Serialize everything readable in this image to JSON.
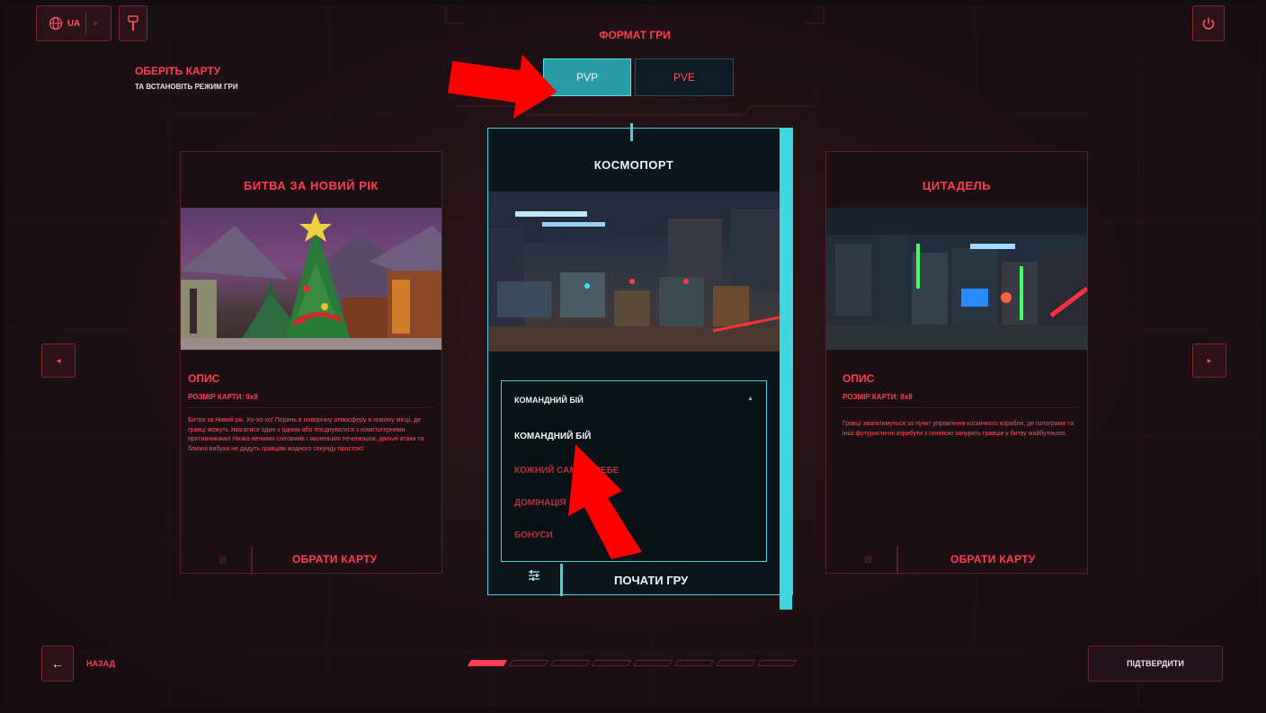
{
  "top": {
    "language": "UA",
    "game_format_label": "ФОРМАТ ГРИ",
    "select_map_title": "ОБЕРІТЬ КАРТУ",
    "select_map_subtitle": "ТА ВСТАНОВІТЬ РЕЖИМ ГРИ",
    "mode_tabs": [
      {
        "label": "PVP",
        "active": true
      },
      {
        "label": "PVE",
        "active": false
      }
    ]
  },
  "cards": {
    "left": {
      "title": "БИТВА ЗА НОВИЙ РІК",
      "description_title": "ОПИС",
      "map_size": "РОЗМІР КАРТИ: 9x8",
      "description": "Битва за Новий рік. Хо-хо-хо! Поринь в новорічну атмосферу в новому місці, де гравці можуть змагатися один з одним або поєднуватися з комп'ютерними противниками! Низка великих сніговиків і маленьких печенюшок, дальні атаки та ближні вибухи не дадуть гравцям жодного секунду простою!",
      "button": "ОБРАТИ КАРТУ"
    },
    "center": {
      "title": "КОСМОПОРТ",
      "dropdown_selected": "КОМАНДНИЙ БІЙ",
      "dropdown_options": [
        "КОМАНДНИЙ БІЙ",
        "КОЖНИЙ САМ ЗА СЕБЕ",
        "ДОМІНАЦІЯ",
        "БОНУСИ"
      ],
      "start_button": "ПОЧАТИ ГРУ"
    },
    "right": {
      "title": "ЦИТАДЕЛЬ",
      "description_title": "ОПИС",
      "map_size": "РОЗМІР КАРТИ: 8x8",
      "description": "Гравці змагатимуться за пункт управління космічного корабля, де голограми та інші футуристичні атрибути з головою занурять гравців у битву майбутнього.",
      "button": "ОБРАТИ КАРТУ"
    }
  },
  "bottom": {
    "back_label": "НАЗАД",
    "confirm_label": "ПІДТВЕРДИТИ",
    "pagination_total": 8,
    "pagination_active": 1
  },
  "icons": {
    "globe": "globe-icon",
    "language_chevron": "chevron-down-icon",
    "tool": "tool-icon",
    "power": "power-icon",
    "prev": "chevron-left-icon",
    "next": "chevron-right-icon",
    "back": "arrow-left-icon",
    "settings": "sliders-icon",
    "dropdown_caret": "caret-up-icon"
  },
  "colors": {
    "accent_red": "#ff3d52",
    "accent_cyan": "#3fd6e0",
    "annotation_arrow": "#ff0000"
  }
}
